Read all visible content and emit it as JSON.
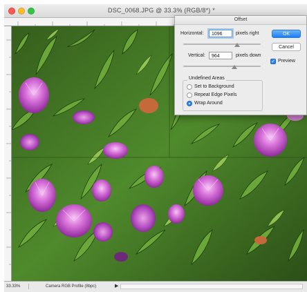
{
  "window": {
    "title": "DSC_0068.JPG @ 33.3% (RGB/8*) *"
  },
  "dialog": {
    "title": "Offset",
    "horizontal_label": "Horizontal:",
    "horizontal_value": "1096",
    "horizontal_unit": "pixels right",
    "vertical_label": "Vertical:",
    "vertical_value": "964",
    "vertical_unit": "pixels down",
    "ok_label": "OK",
    "cancel_label": "Cancel",
    "preview_label": "Preview",
    "preview_checked": true,
    "undefined_areas": {
      "title": "Undefined Areas",
      "options": [
        "Set to Background",
        "Repeat Edge Pixels",
        "Wrap Around"
      ],
      "selected": "Wrap Around"
    }
  },
  "status": {
    "zoom": "33.33%",
    "profile": "Camera RGB Profile (8bpc)",
    "arrow": "▶"
  },
  "icons": {
    "close": "close-icon",
    "minimize": "minimize-icon",
    "zoom": "zoom-icon",
    "checkbox": "checkmark-icon"
  },
  "colors": {
    "accent": "#1b7ef6",
    "close": "#fc5b57",
    "minimize": "#fdbc2e",
    "zoom": "#33c748",
    "foliage": "#3f6b22",
    "flower": "#c35bd6"
  }
}
